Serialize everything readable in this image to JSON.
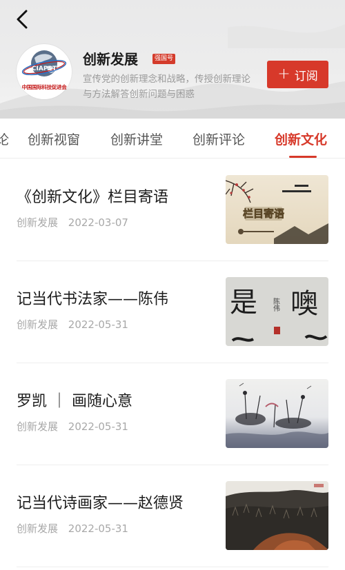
{
  "header": {
    "logo": {
      "emblem_text": "CIAPST",
      "caption": "中国国际科技促进会"
    },
    "title": "创新发展",
    "badge": "强国号",
    "description": "宣传党的创新理念和战略，传授创新理论与方法解答创新问题与困惑",
    "subscribe_label": "订阅",
    "accent_color": "#d7392a"
  },
  "tabs": [
    {
      "label": "论",
      "active": false
    },
    {
      "label": "创新视窗",
      "active": false
    },
    {
      "label": "创新讲堂",
      "active": false
    },
    {
      "label": "创新评论",
      "active": false
    },
    {
      "label": "创新文化",
      "active": true
    }
  ],
  "articles": [
    {
      "title": "《创新文化》栏目寄语",
      "source": "创新发展",
      "date": "2022-03-07",
      "thumb_text": "栏目寄语"
    },
    {
      "title": "记当代书法家——陈伟",
      "source": "创新发展",
      "date": "2022-05-31",
      "thumb_text": "是 噢 陈伟"
    },
    {
      "title": "罗凯 ｜ 画随心意",
      "source": "创新发展",
      "date": "2022-05-31"
    },
    {
      "title": "记当代诗画家——赵德贤",
      "source": "创新发展",
      "date": "2022-05-31"
    }
  ]
}
